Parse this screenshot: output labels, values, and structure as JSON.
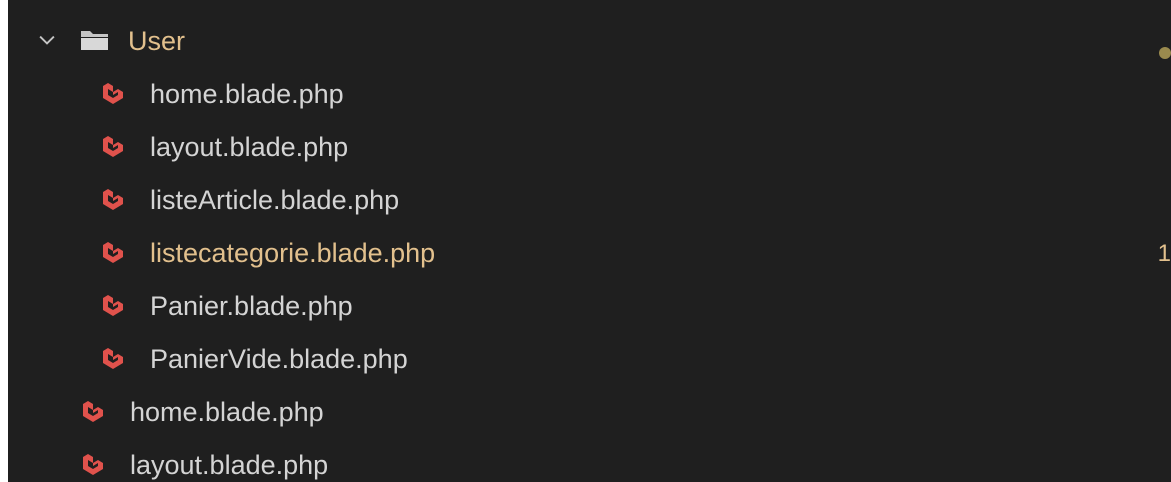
{
  "explorer": {
    "folder": {
      "name": "User",
      "expanded": true,
      "icon": "folder-open-icon",
      "color": "#e2c08d"
    },
    "children": [
      {
        "name": "home.blade.php",
        "icon": "laravel-icon",
        "modified": false
      },
      {
        "name": "layout.blade.php",
        "icon": "laravel-icon",
        "modified": false
      },
      {
        "name": "listeArticle.blade.php",
        "icon": "laravel-icon",
        "modified": false
      },
      {
        "name": "listecategorie.blade.php",
        "icon": "laravel-icon",
        "modified": true,
        "badge": "1"
      },
      {
        "name": "Panier.blade.php",
        "icon": "laravel-icon",
        "modified": false
      },
      {
        "name": "PanierVide.blade.php",
        "icon": "laravel-icon",
        "modified": false
      }
    ],
    "siblings": [
      {
        "name": "home.blade.php",
        "icon": "laravel-icon"
      },
      {
        "name": "layout.blade.php",
        "icon": "laravel-icon"
      }
    ],
    "colors": {
      "background": "#1f1f1f",
      "text": "#d4d4d4",
      "modified": "#e2c08d",
      "laravel": "#e0524c"
    }
  }
}
